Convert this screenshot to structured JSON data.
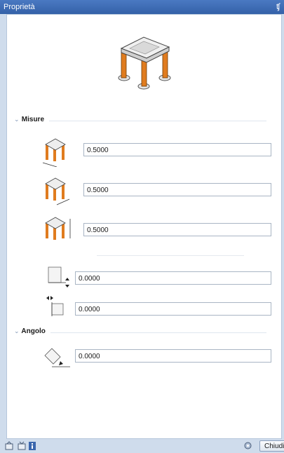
{
  "window": {
    "title": "Proprietà",
    "pin_icon": "pin-icon"
  },
  "sections": {
    "misure": {
      "label": "Misure"
    },
    "angolo": {
      "label": "Angolo"
    }
  },
  "fields": {
    "width": {
      "value": "0.5000",
      "icon": "dimension-width-icon"
    },
    "depth": {
      "value": "0.5000",
      "icon": "dimension-depth-icon"
    },
    "height": {
      "value": "0.5000",
      "icon": "dimension-height-icon"
    },
    "offset_vertical": {
      "value": "0.0000",
      "icon": "offset-vertical-icon"
    },
    "offset_horizontal": {
      "value": "0.0000",
      "icon": "offset-horizontal-icon"
    },
    "angle": {
      "value": "0.0000",
      "icon": "rotation-angle-icon"
    }
  },
  "footer": {
    "close_label": "Chiudi"
  },
  "colors": {
    "accent": "#3a66ad",
    "column": "#e07c1f",
    "background": "#cfdcec"
  }
}
